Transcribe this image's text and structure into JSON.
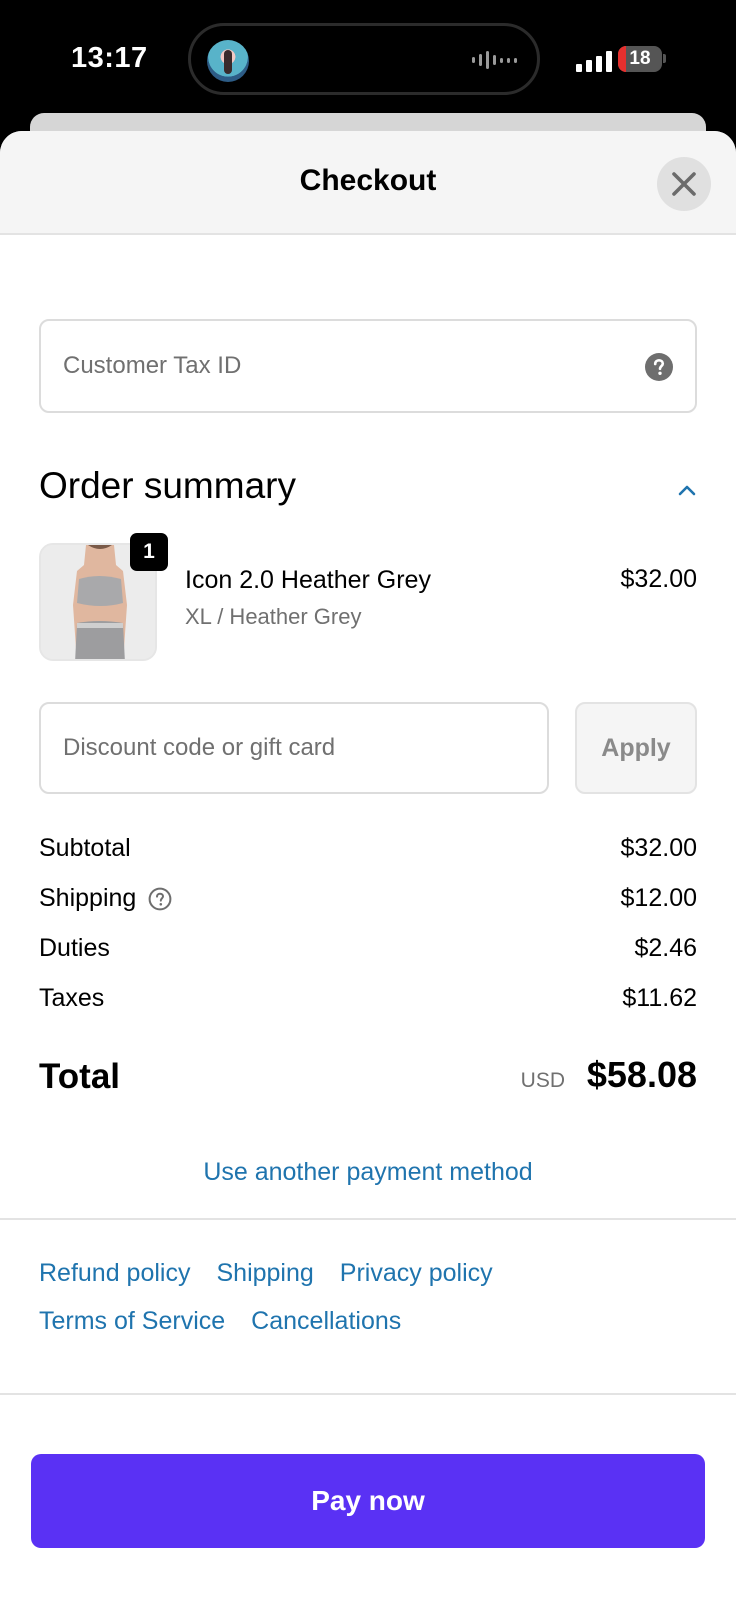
{
  "status_bar": {
    "time": "13:17",
    "battery_level": "18",
    "battery_fraction": 0.18,
    "battery_color": "#e5302e"
  },
  "header": {
    "title": "Checkout",
    "close_icon": "close-icon"
  },
  "tax_id": {
    "placeholder": "Customer Tax ID",
    "help_icon": "question-circle-icon"
  },
  "order_summary": {
    "heading": "Order summary",
    "toggle_icon": "chevron-up-icon",
    "item": {
      "quantity": "1",
      "name": "Icon 2.0 Heather Grey",
      "variant": "XL / Heather Grey",
      "price": "$32.00"
    }
  },
  "discount": {
    "placeholder": "Discount code or gift card",
    "apply_label": "Apply"
  },
  "summary_rows": [
    {
      "label": "Subtotal",
      "value": "$32.00"
    },
    {
      "label": "Shipping",
      "value": "$12.00",
      "help_icon": "question-circle-outline-icon"
    },
    {
      "label": "Duties",
      "value": "$2.46"
    },
    {
      "label": "Taxes",
      "value": "$11.62"
    }
  ],
  "total": {
    "label": "Total",
    "currency": "USD",
    "value": "$58.08"
  },
  "alt_payment_label": "Use another payment method",
  "policy_links": [
    "Refund policy",
    "Shipping",
    "Privacy policy",
    "Terms of Service",
    "Cancellations"
  ],
  "pay_button_label": "Pay now",
  "colors": {
    "link": "#1f74ae",
    "pay_button": "#5a31f4",
    "header_bg": "#f5f5f5"
  }
}
